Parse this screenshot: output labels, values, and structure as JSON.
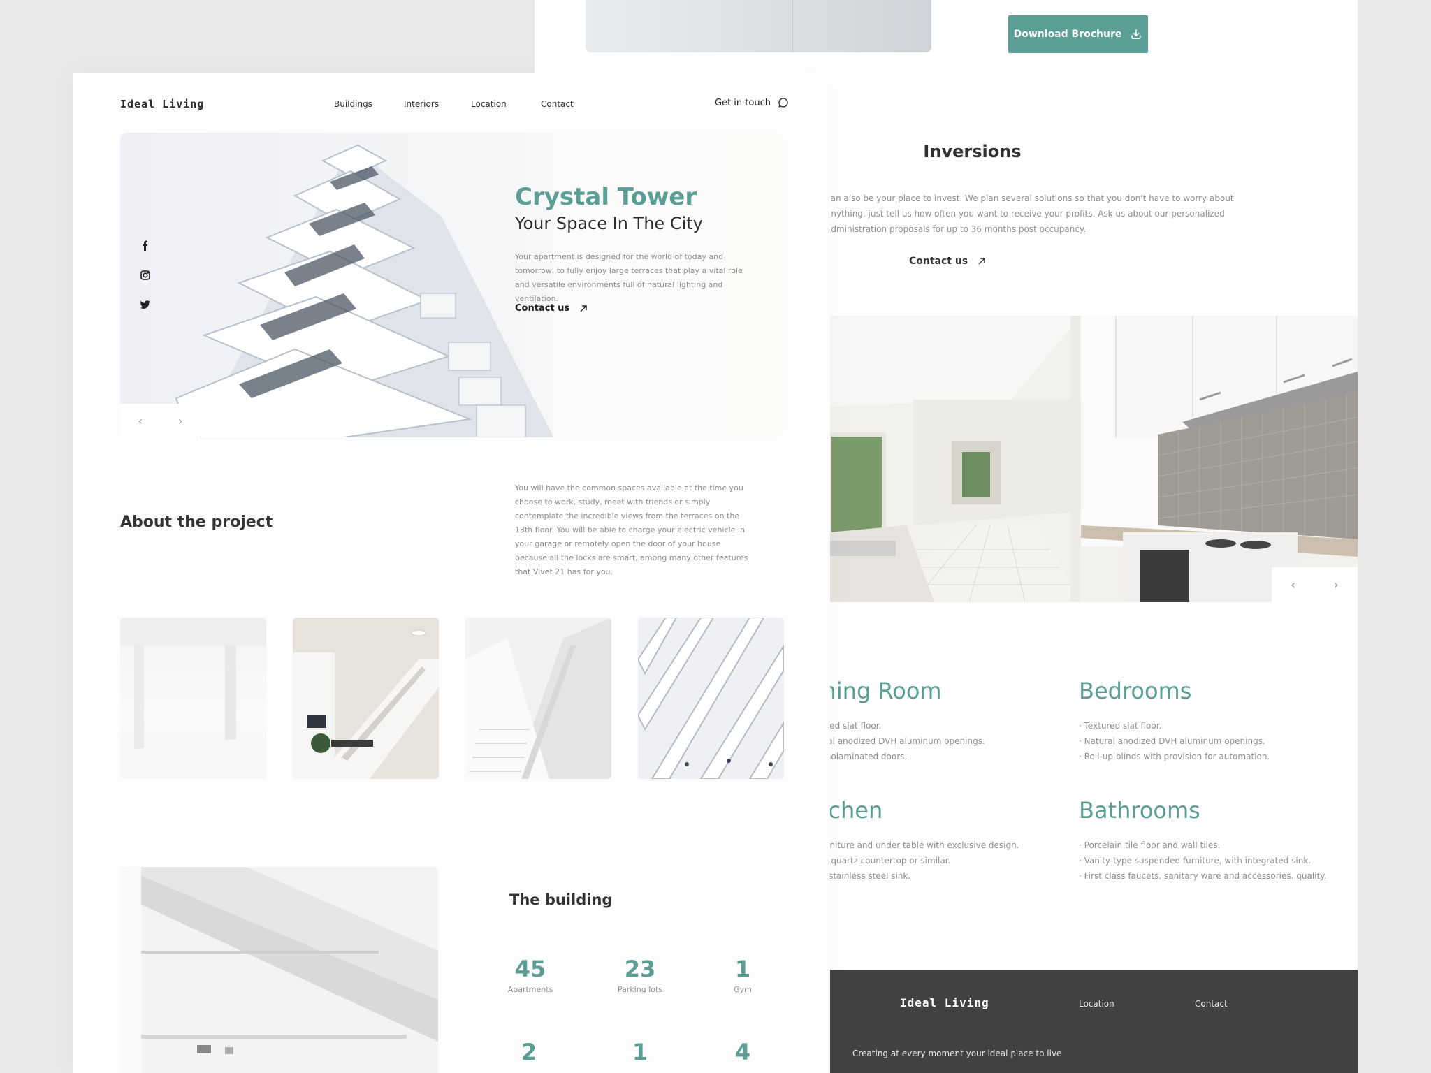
{
  "back_page": {
    "download_button": "Download Brochure",
    "inversions": {
      "title": "Inversions",
      "text": "can also be your place to invest. We plan several solutions so that you don't have to worry about anything, just tell us how often you want to receive your profits. Ask us about our personalized administration proposals for up to 36 months post occupancy.",
      "contact": "Contact us"
    },
    "rooms": [
      {
        "title": "Dining Room",
        "items": [
          "Textured slat floor.",
          "Natural anodized DVH aluminum openings.",
          "Thermolaminated doors."
        ]
      },
      {
        "title": "Bedrooms",
        "items": [
          "Textured slat floor.",
          "Natural anodized DVH aluminum openings.",
          "Roll-up blinds with provision for automation."
        ]
      },
      {
        "title": "Kitchen",
        "items": [
          "Air furniture and under table with exclusive design.",
          "White quartz countertop or similar.",
          "Deep stainless steel sink."
        ]
      },
      {
        "title": "Bathrooms",
        "items": [
          "Porcelain tile floor and wall tiles.",
          "Vanity-type suspended furniture, with integrated sink.",
          "First class faucets, sanitary ware and accessories. quality."
        ]
      }
    ],
    "footer": {
      "logo": "Ideal Living",
      "links": [
        "Location",
        "Contact"
      ],
      "tagline": "Creating at every moment your ideal place to live"
    }
  },
  "front_page": {
    "logo": "Ideal Living",
    "nav": [
      "Buildings",
      "Interiors",
      "Location",
      "Contact"
    ],
    "get_in_touch": "Get in touch",
    "hero": {
      "title": "Crystal Tower",
      "subtitle": "Your Space In The City",
      "text": "Your apartment is designed for the world of today and tomorrow, to fully enjoy large terraces that play a vital role and versatile environments full of natural lighting and ventilation.",
      "contact": "Contact us"
    },
    "about": {
      "title": "About the project",
      "text": "You will have the common spaces available at the time you choose to work, study, meet with friends or simply contemplate the incredible views from the terraces on the 13th floor. You will be able to charge your electric vehicle in your garage or remotely open the door of your house because all the locks are smart, among many other features that Vivet 21 has for you."
    },
    "building": {
      "title": "The building",
      "stats": [
        {
          "num": "45",
          "label": "Apartments"
        },
        {
          "num": "23",
          "label": "Parking lots"
        },
        {
          "num": "1",
          "label": "Gym"
        },
        {
          "num": "2",
          "label": ""
        },
        {
          "num": "1",
          "label": ""
        },
        {
          "num": "4",
          "label": ""
        }
      ]
    }
  },
  "colors": {
    "accent": "#5a9e95",
    "footer": "#414141",
    "body_text": "#8e8e8e"
  }
}
